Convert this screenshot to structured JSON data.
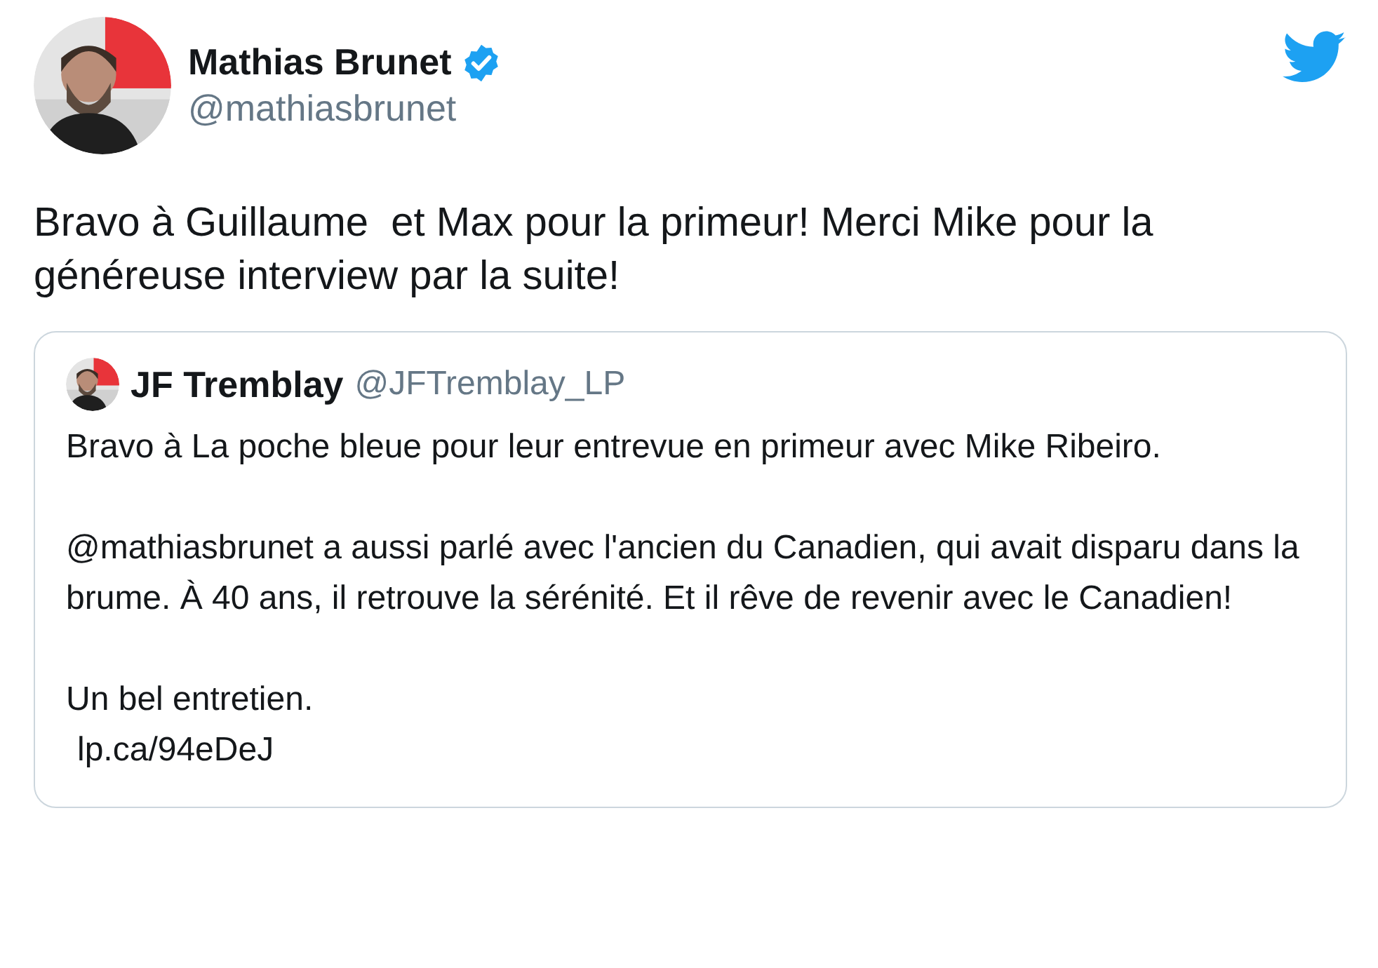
{
  "tweet": {
    "author": {
      "name": "Mathias Brunet",
      "handle": "@mathiasbrunet",
      "verified": true
    },
    "text": "Bravo à Guillaume  et Max pour la primeur! Merci Mike pour la généreuse interview par la suite!",
    "quoted_tweet": {
      "author": {
        "name": "JF Tremblay",
        "handle": "@JFTremblay_LP"
      },
      "paragraphs": [
        "Bravo à La poche bleue pour leur entrevue en primeur avec Mike Ribeiro.",
        "@mathiasbrunet a aussi parlé avec l'ancien du Canadien, qui avait disparu dans la brume. À 40 ans, il retrouve la sérénité. Et il rêve de revenir avec le Canadien!",
        "Un bel entretien."
      ],
      "link": "lp.ca/94eDeJ"
    }
  }
}
